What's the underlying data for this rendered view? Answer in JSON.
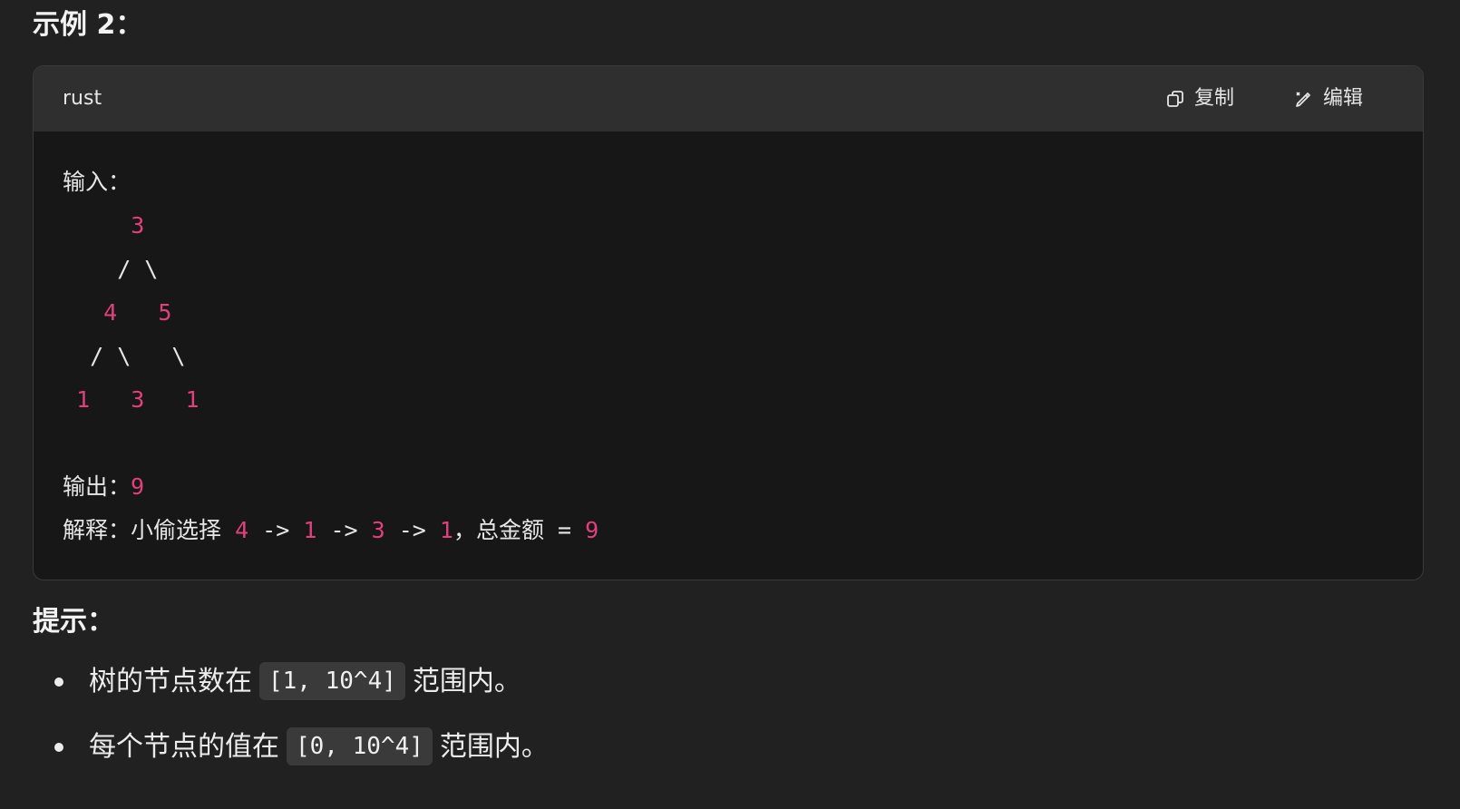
{
  "example_title": "示例 2：",
  "code_block": {
    "language": "rust",
    "copy_label": "复制",
    "edit_label": "编辑",
    "lines": [
      [
        {
          "t": "输入："
        }
      ],
      [
        {
          "t": "     "
        },
        {
          "t": "3",
          "n": true
        }
      ],
      [
        {
          "t": "    / \\"
        }
      ],
      [
        {
          "t": "   "
        },
        {
          "t": "4",
          "n": true
        },
        {
          "t": "   "
        },
        {
          "t": "5",
          "n": true
        }
      ],
      [
        {
          "t": "  / \\   \\"
        }
      ],
      [
        {
          "t": " "
        },
        {
          "t": "1",
          "n": true
        },
        {
          "t": "   "
        },
        {
          "t": "3",
          "n": true
        },
        {
          "t": "   "
        },
        {
          "t": "1",
          "n": true
        }
      ],
      [
        {
          "t": ""
        }
      ],
      [
        {
          "t": "输出："
        },
        {
          "t": "9",
          "n": true
        }
      ],
      [
        {
          "t": "解释：小偷选择 "
        },
        {
          "t": "4",
          "n": true
        },
        {
          "t": " -> "
        },
        {
          "t": "1",
          "n": true
        },
        {
          "t": " -> "
        },
        {
          "t": "3",
          "n": true
        },
        {
          "t": " -> "
        },
        {
          "t": "1",
          "n": true
        },
        {
          "t": "，总金额 = "
        },
        {
          "t": "9",
          "n": true
        }
      ]
    ]
  },
  "hint_title": "提示：",
  "hints": [
    {
      "before": "树的节点数在",
      "code": "[1, 10^4]",
      "after": "范围内。"
    },
    {
      "before": "每个节点的值在",
      "code": "[0, 10^4]",
      "after": "范围内。"
    }
  ],
  "colors": {
    "background": "#212121",
    "code_background": "#171717",
    "header_background": "#2f2f2f",
    "number": "#e0407b"
  }
}
